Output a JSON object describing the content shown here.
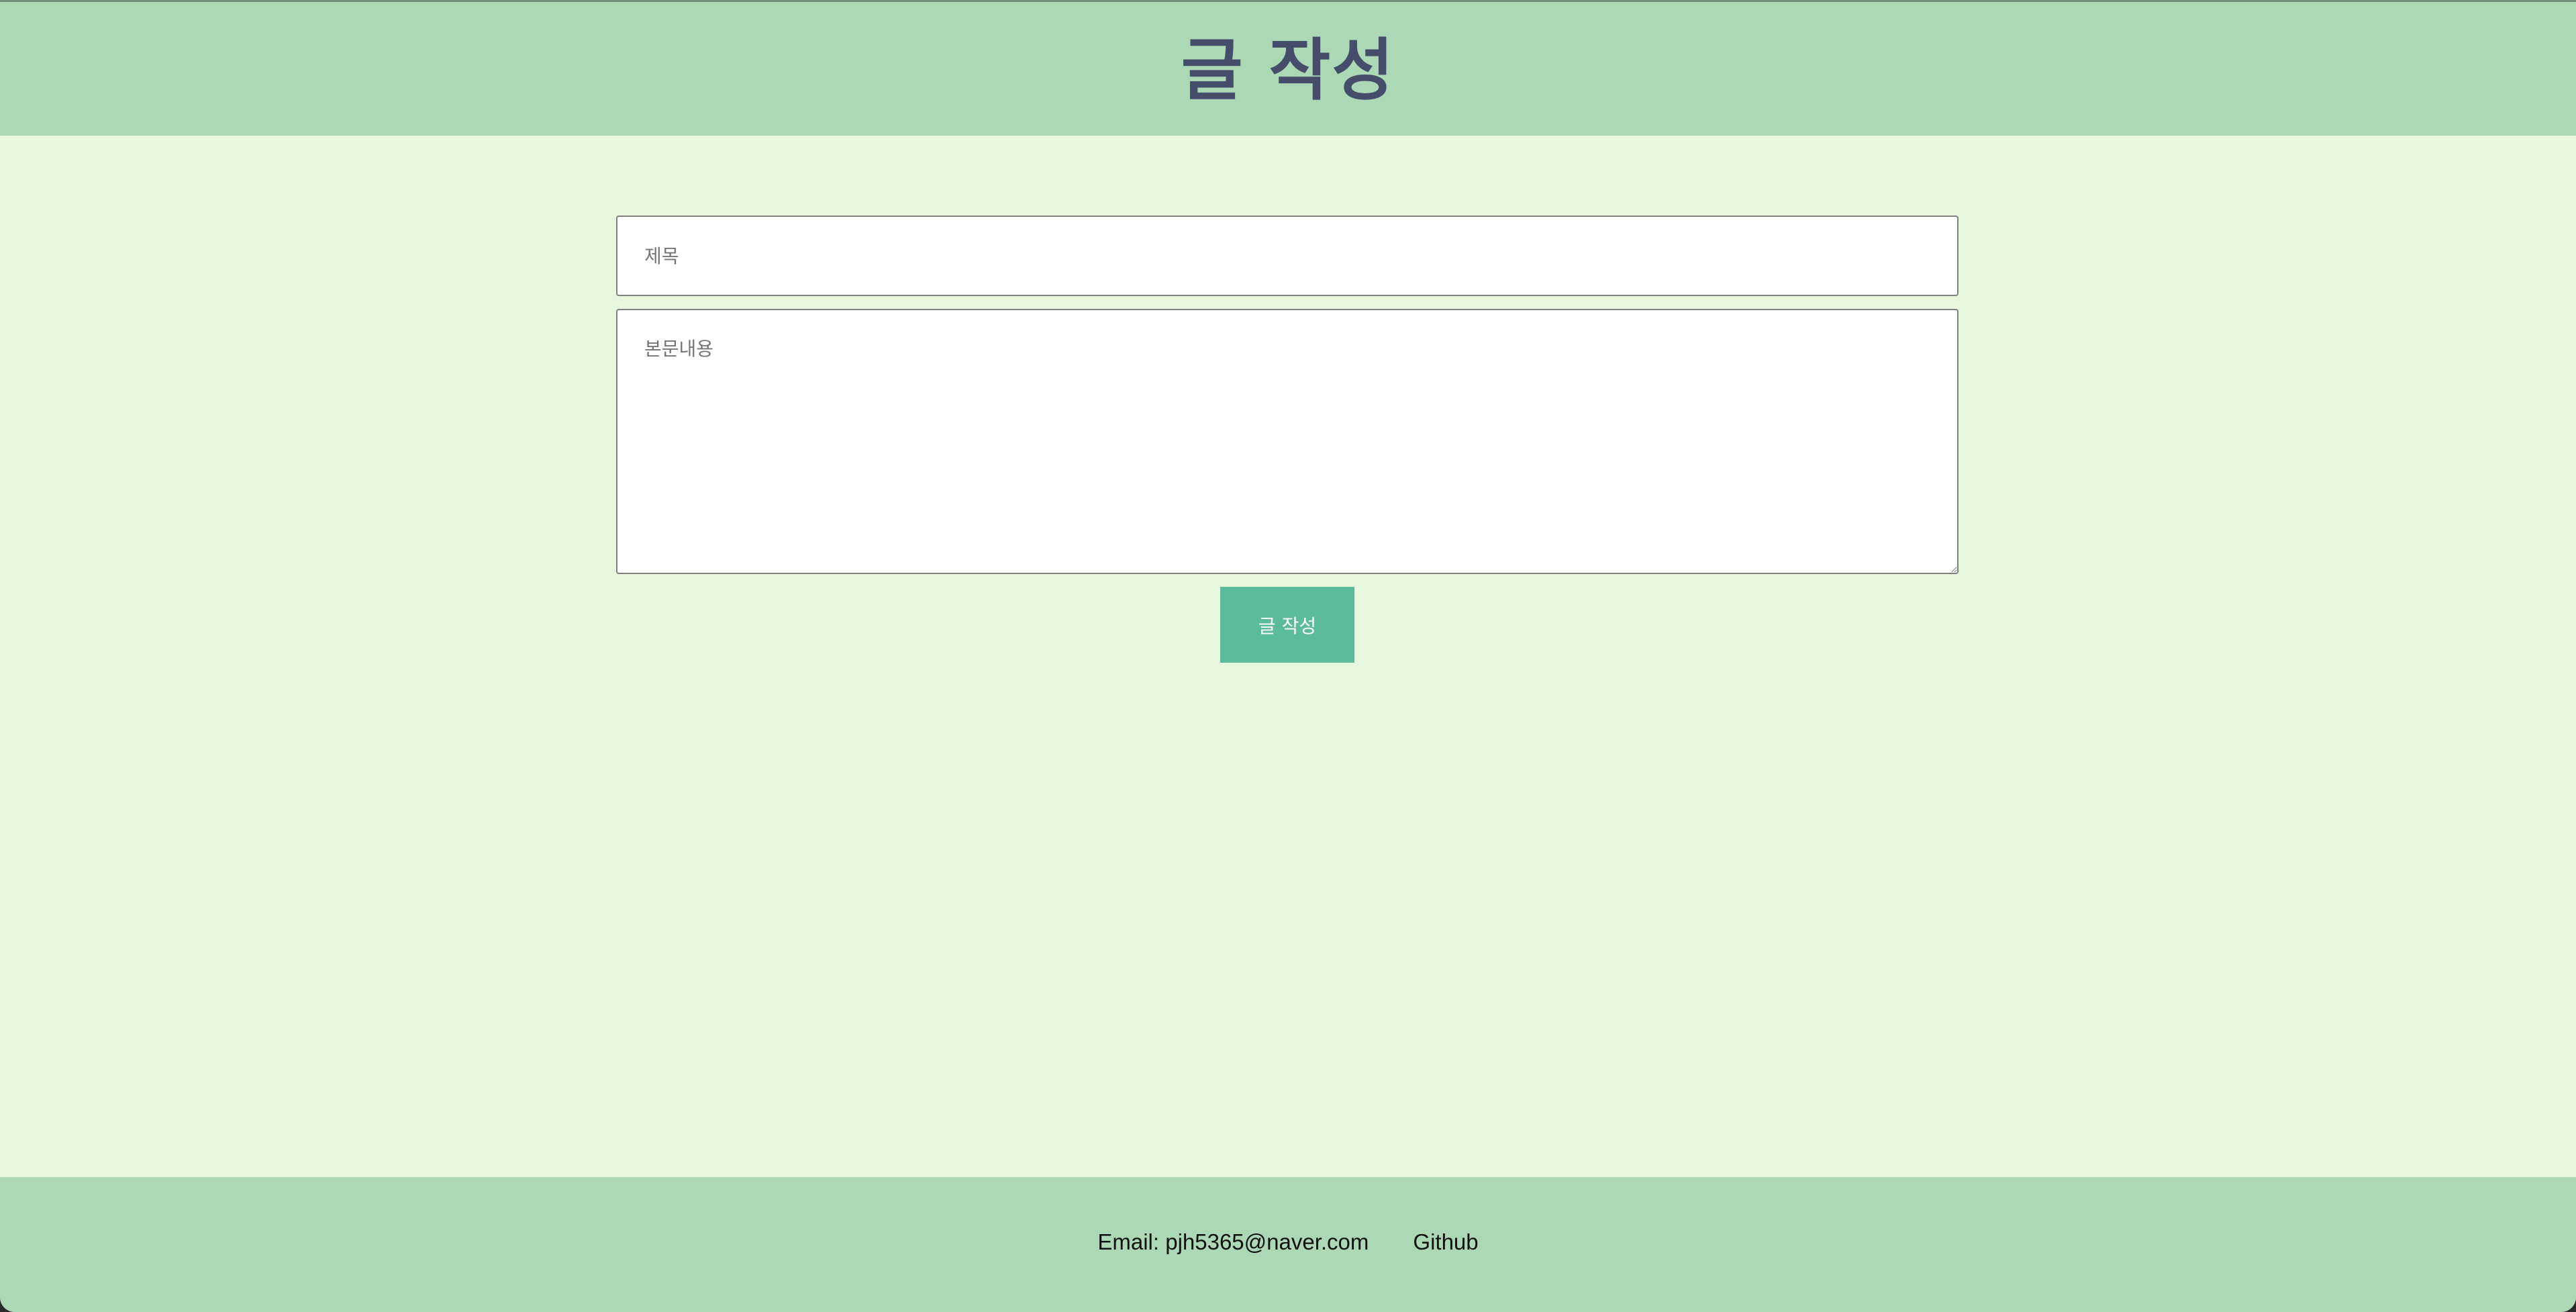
{
  "header": {
    "title": "글 작성"
  },
  "form": {
    "title_placeholder": "제목",
    "title_value": "",
    "body_placeholder": "본문내용",
    "body_value": "",
    "submit_label": "글 작성"
  },
  "footer": {
    "email_text": "Email: pjh5365@naver.com",
    "github_label": "Github"
  },
  "colors": {
    "header_bg": "#acd8b6",
    "page_bg": "#e7f7de",
    "title_text": "#454d6b",
    "button_bg": "#5cbb9c"
  }
}
